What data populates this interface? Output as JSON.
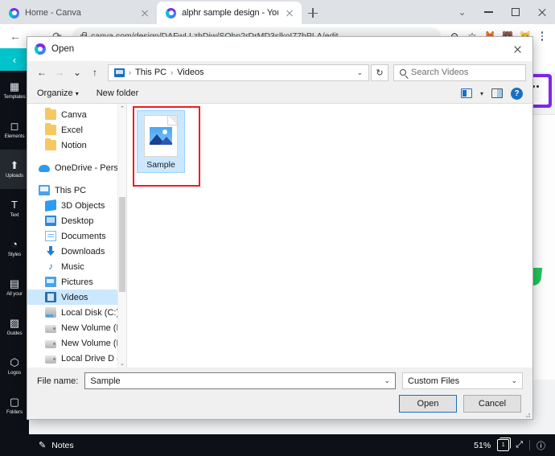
{
  "browser": {
    "tabs": [
      {
        "title": "Home - Canva",
        "active": false
      },
      {
        "title": "alphr sample design - YouTube T",
        "active": true
      }
    ],
    "new_tab_label": "+",
    "window_controls": {
      "profile": "profile-chevron",
      "minimize": "–",
      "maximize": "□",
      "close": "✕"
    },
    "toolbar": {
      "back": "←",
      "forward": "→",
      "reload": "⟳",
      "url": "canva.com/design/DAFwLLzhDiw/SOhn2rDrMD3slkoI77hPLA/edit",
      "zoom_icon": "⊖",
      "bookmark_icon": "☆",
      "ext1": "🦊",
      "ext2": "🐻",
      "ext3": "🐱",
      "menu": "kebab-menu"
    }
  },
  "canva": {
    "rail": {
      "back_label": "‹",
      "items": [
        {
          "label": "Templates",
          "icon": "▦",
          "active": false
        },
        {
          "label": "Elements",
          "icon": "◻",
          "active": false
        },
        {
          "label": "Uploads",
          "icon": "⬆",
          "active": true
        },
        {
          "label": "Text",
          "icon": "T",
          "active": false
        },
        {
          "label": "Styles",
          "icon": "◔",
          "active": false
        },
        {
          "label": "All your",
          "icon": "▤",
          "active": false
        },
        {
          "label": "Guides",
          "icon": "▨",
          "active": false
        },
        {
          "label": "Logos",
          "icon": "⬡",
          "active": false
        },
        {
          "label": "Folders",
          "icon": "▢",
          "active": false
        }
      ]
    },
    "statusbar": {
      "notes_label": "Notes",
      "notes_icon": "notes-icon",
      "zoom": "51%",
      "page_number": "1",
      "fullscreen_icon": "⤢",
      "help_icon": "?"
    },
    "element_menu_icon": "more-options-icon"
  },
  "dialog": {
    "title": "Open",
    "close_label": "✕",
    "nav": {
      "back": "←",
      "forward": "→",
      "recent": "⌄",
      "up": "↑"
    },
    "breadcrumb": {
      "root_icon": "this-pc-icon",
      "parts": [
        "This PC",
        "Videos"
      ],
      "separator": "›",
      "dropdown": "⌄"
    },
    "refresh_icon": "↻",
    "search": {
      "placeholder": "Search Videos",
      "icon": "search-icon"
    },
    "toolbar": {
      "organize_label": "Organize",
      "organize_caret": "▾",
      "new_folder_label": "New folder",
      "view_caret": "▾",
      "help_label": "?"
    },
    "sidebar": {
      "groups": [
        {
          "items": [
            {
              "label": "Canva",
              "icon": "folder",
              "indent": true,
              "selected": false
            },
            {
              "label": "Excel",
              "icon": "folder",
              "indent": true,
              "selected": false
            },
            {
              "label": "Notion",
              "icon": "folder",
              "indent": true,
              "selected": false
            }
          ]
        },
        {
          "items": [
            {
              "label": "OneDrive - Person",
              "icon": "cloud",
              "indent": false,
              "selected": false
            }
          ]
        },
        {
          "items": [
            {
              "label": "This PC",
              "icon": "pc",
              "indent": false,
              "selected": false
            },
            {
              "label": "3D Objects",
              "icon": "3d",
              "indent": true,
              "selected": false
            },
            {
              "label": "Desktop",
              "icon": "desktop",
              "indent": true,
              "selected": false
            },
            {
              "label": "Documents",
              "icon": "documents",
              "indent": true,
              "selected": false
            },
            {
              "label": "Downloads",
              "icon": "downloads",
              "indent": true,
              "selected": false
            },
            {
              "label": "Music",
              "icon": "music",
              "indent": true,
              "selected": false
            },
            {
              "label": "Pictures",
              "icon": "pictures",
              "indent": true,
              "selected": false
            },
            {
              "label": "Videos",
              "icon": "videos",
              "indent": true,
              "selected": true
            },
            {
              "label": "Local Disk (C:)",
              "icon": "disk",
              "indent": true,
              "selected": false
            },
            {
              "label": "New Volume (D:)",
              "icon": "drive",
              "indent": true,
              "selected": false
            },
            {
              "label": "New Volume (E:)",
              "icon": "drive",
              "indent": true,
              "selected": false
            },
            {
              "label": "Local Drive D (F:)",
              "icon": "drive",
              "indent": true,
              "selected": false
            }
          ]
        }
      ],
      "scroll_up": "⌃",
      "scroll_down": "⌄"
    },
    "files": [
      {
        "name": "Sample",
        "type": "image",
        "selected": true,
        "highlighted": true
      }
    ],
    "footer": {
      "filename_label": "File name:",
      "filename_value": "Sample",
      "filename_caret": "⌄",
      "filetype_value": "Custom Files",
      "filetype_caret": "⌄",
      "open_label": "Open",
      "cancel_label": "Cancel"
    }
  },
  "colors": {
    "accent_blue": "#1b6ec2",
    "selection_blue": "#cce8ff",
    "annotation_red": "#ee1b24",
    "canva_teal": "#00c4cc",
    "canva_dark": "#0d1117",
    "purple": "#7d2ae8",
    "green": "#21c35a"
  }
}
